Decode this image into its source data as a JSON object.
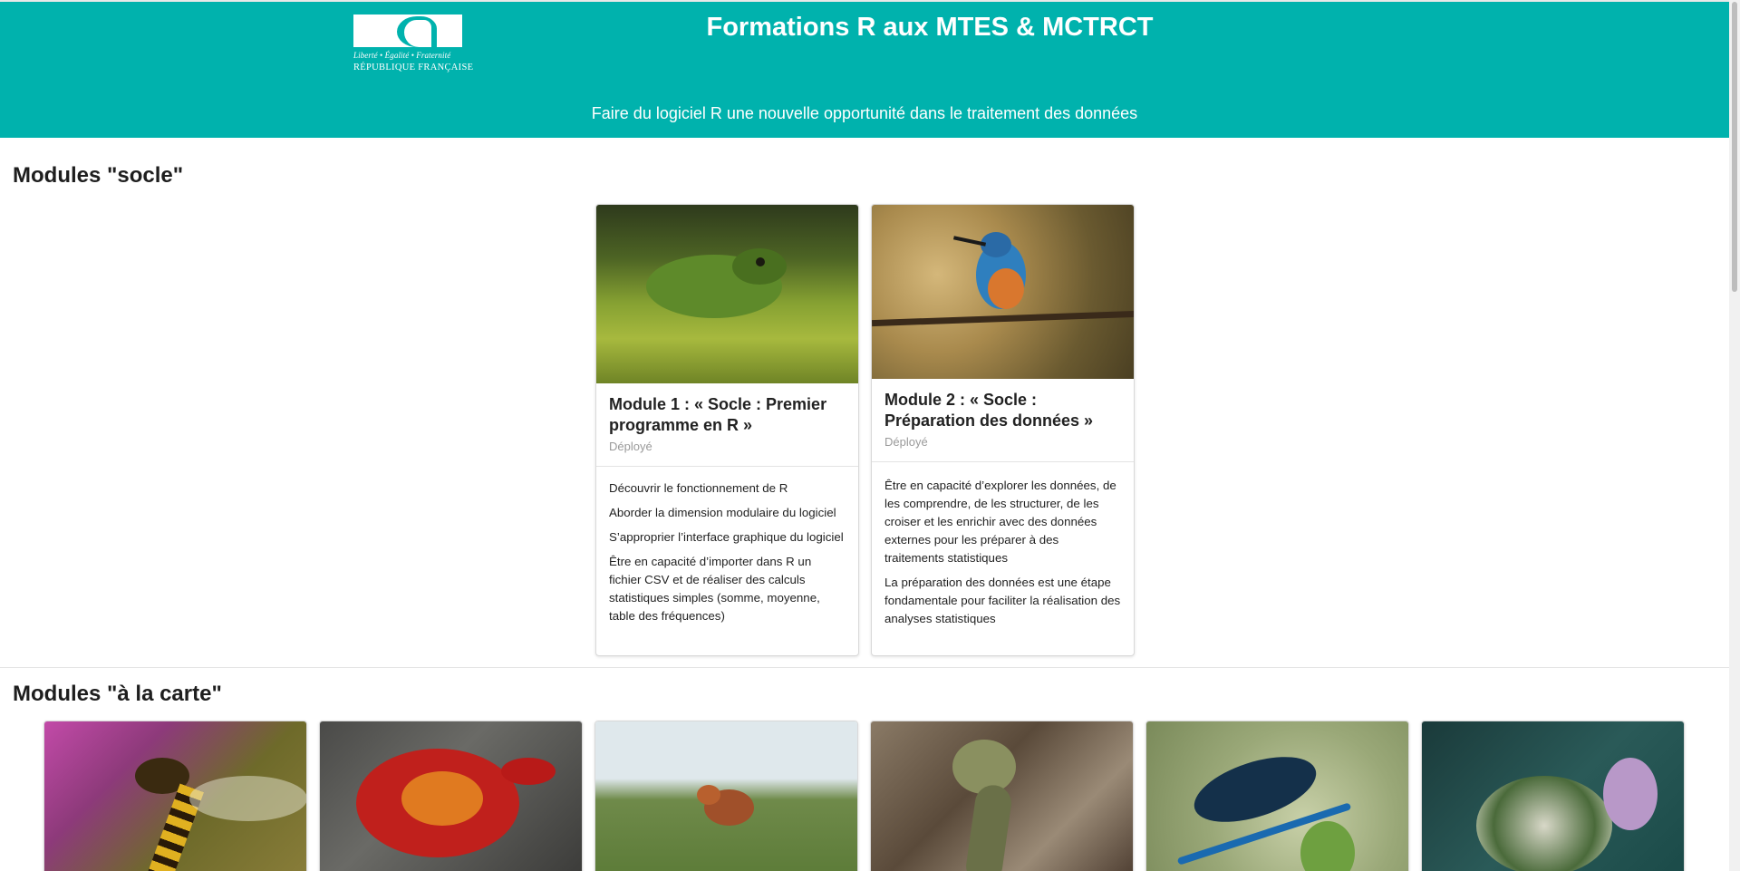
{
  "header": {
    "logo": {
      "motto": "Liberté • Égalité • Fraternité",
      "republic": "RÉPUBLIQUE FRANÇAISE"
    },
    "title": "Formations R aux MTES & MCTRCT",
    "subtitle": "Faire du logiciel R une nouvelle opportunité dans le traitement des données",
    "background_color": "#00b2ad"
  },
  "sections": {
    "socle": {
      "title": "Modules \"socle\"",
      "cards": [
        {
          "image": "frog-photo",
          "title": "Module 1 : « Socle : Premier programme en R »",
          "status": "Déployé",
          "points": [
            "Découvrir le fonctionnement de R",
            "Aborder la dimension modulaire du logiciel",
            "S’approprier l’interface graphique du logiciel",
            "Être en capacité d’importer dans R un fichier CSV et de réaliser des calculs statistiques simples (somme, moyenne, table des fréquences)"
          ]
        },
        {
          "image": "kingfisher-photo",
          "title": "Module 2 : « Socle : Préparation des données »",
          "status": "Déployé",
          "points": [
            "Être en capacité d’explorer les données, de les comprendre, de les structurer, de les croiser et les enrichir avec des données externes pour les préparer à des traitements statistiques",
            "La préparation des données est une étape fondamentale pour faciliter la réalisation des analyses statistiques"
          ]
        }
      ]
    },
    "carte": {
      "title": "Modules \"à la carte\"",
      "images": [
        "hoverfly-photo",
        "crab-photo",
        "fox-photo",
        "snake-photo",
        "damselfly-photo",
        "butterfly-photo"
      ]
    }
  }
}
